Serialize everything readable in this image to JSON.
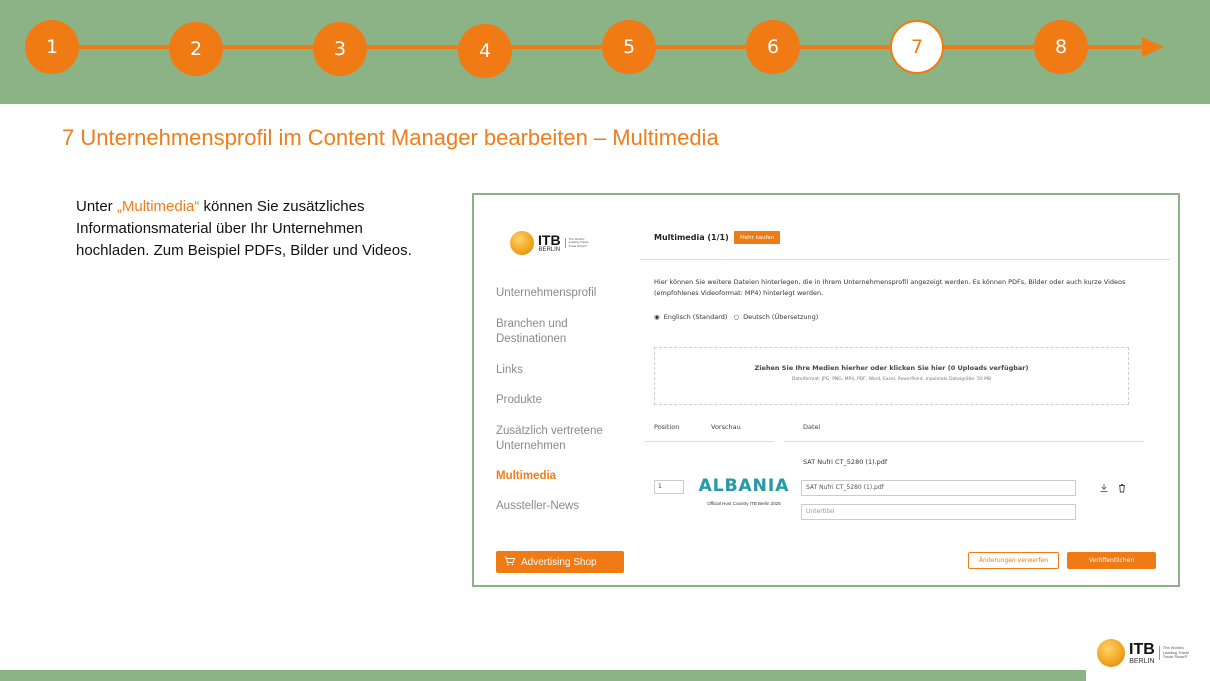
{
  "steps": [
    {
      "label": "1",
      "active": false
    },
    {
      "label": "2",
      "active": false
    },
    {
      "label": "3",
      "active": false
    },
    {
      "label": "4",
      "active": false
    },
    {
      "label": "5",
      "active": false
    },
    {
      "label": "6",
      "active": false
    },
    {
      "label": "7",
      "active": true
    },
    {
      "label": "8",
      "active": false
    }
  ],
  "slide": {
    "title": "7 Unternehmensprofil im Content Manager bearbeiten – Multimedia",
    "desc_prefix": "Unter ",
    "desc_highlight": "„Multimedia“",
    "desc_rest": " können Sie zusätzliches Informationsmaterial über Ihr Unternehmen hochladen. Zum Beispiel PDFs, Bilder und Videos."
  },
  "logo": {
    "itb": "ITB",
    "berlin": "BERLIN",
    "tagline": "The World's Leading Travel Trade Show®"
  },
  "sidebar": {
    "items": [
      {
        "label": "Unternehmensprofil",
        "active": false
      },
      {
        "label": "Branchen und Destinationen",
        "active": false
      },
      {
        "label": "Links",
        "active": false
      },
      {
        "label": "Produkte",
        "active": false
      },
      {
        "label": "Zusätzlich vertretene Unternehmen",
        "active": false
      },
      {
        "label": "Multimedia",
        "active": true
      },
      {
        "label": "Aussteller-News",
        "active": false
      }
    ],
    "ad_button": "Advertising Shop"
  },
  "main": {
    "title": "Multimedia (1/1)",
    "buy_button": "Mehr kaufen",
    "info": "Hier können Sie weitere Dateien hinterlegen, die in Ihrem Unternehmensprofil angezeigt werden. Es können PDFs, Bilder oder auch kurze Videos (empfohlenes Videoformat: MP4) hinterlegt werden.",
    "radio_en": "Englisch (Standard)",
    "radio_de": "Deutsch (Übersetzung)",
    "dropzone_main": "Ziehen Sie Ihre Medien hierher oder klicken Sie hier (0 Uploads verfügbar)",
    "dropzone_sub": "Dateiformat: JPG, PNG, MP4, PDF, Word, Excel, PowerPoint, maximale Dateigröße: 50 MB",
    "table": {
      "col_position": "Position",
      "col_preview": "Vorschau",
      "col_file": "Datei"
    },
    "row": {
      "filename": "SAT Nufri CT_5280 (1).pdf",
      "position": "1",
      "preview_word": "ALBANIA",
      "preview_caption": "Official Host Country ITB Berlin 2025",
      "file_value": "SAT Nufri CT_5280 (1).pdf",
      "subtitle_placeholder": "Untertitel"
    },
    "discard_button": "Änderungen verwerfen",
    "publish_button": "Veröffentlichen"
  }
}
